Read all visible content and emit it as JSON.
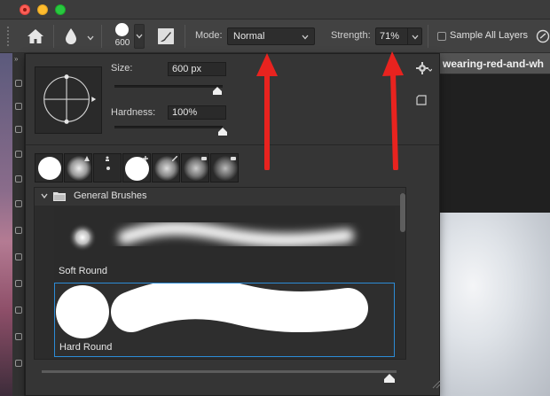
{
  "options_bar": {
    "brush_size": "600",
    "mode_label": "Mode:",
    "mode_value": "Normal",
    "strength_label": "Strength:",
    "strength_value": "71%",
    "sample_all_layers_label": "Sample All Layers",
    "sample_all_layers_checked": false
  },
  "brush_panel": {
    "size_label": "Size:",
    "size_value": "600 px",
    "hardness_label": "Hardness:",
    "hardness_value": "100%",
    "size_slider_fraction": 0.95,
    "hardness_slider_fraction": 1.0,
    "group_title": "General Brushes",
    "brushes": [
      {
        "name": "Soft Round",
        "selected": false
      },
      {
        "name": "Hard Round",
        "selected": true
      }
    ],
    "preview_size_slider_fraction": 0.98
  },
  "document": {
    "tab_title": "wearing-red-and-wh"
  },
  "icons": {
    "home": "home-icon",
    "tool": "water-drop-icon",
    "settings": "gear-icon",
    "new_preset": "new-preset-icon",
    "brush_settings": "brush-settings-icon",
    "pressure": "pressure-icon"
  },
  "colors": {
    "selection_outline": "#2c8bd6",
    "annotation_arrow": "#e8231f",
    "panel_bg": "#353535"
  }
}
